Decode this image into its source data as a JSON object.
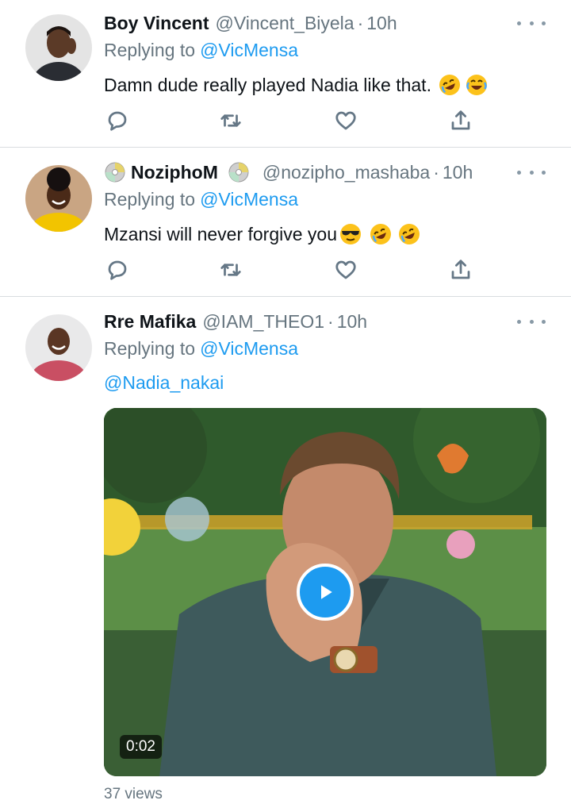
{
  "tweets": [
    {
      "name": "Boy Vincent",
      "handle": "@Vincent_Biyela",
      "separator": "·",
      "time": "10h",
      "replying_prefix": "Replying to",
      "replying_to": "@VicMensa",
      "text": "Damn dude really played Nadia like that.",
      "emojis": [
        "rofl-emoji",
        "joy-emoji"
      ]
    },
    {
      "name": "NoziphoM",
      "handle": "@nozipho_mashaba",
      "separator": "·",
      "time": "10h",
      "replying_prefix": "Replying to",
      "replying_to": "@VicMensa",
      "text": "Mzansi will never forgive you",
      "emojis": [
        "sunglasses-emoji",
        "rofl-emoji",
        "rofl-emoji"
      ]
    },
    {
      "name": "Rre Mafika",
      "handle": "@IAM_THEO1",
      "separator": "·",
      "time": "10h",
      "replying_prefix": "Replying to",
      "replying_to": "@VicMensa",
      "mention": "@Nadia_nakai",
      "video_duration": "0:02",
      "views": "37 views"
    }
  ],
  "icons": {
    "reply": "reply-icon",
    "retweet": "retweet-icon",
    "like": "heart-icon",
    "share": "share-icon",
    "more": "more-options-icon",
    "play": "play-icon"
  },
  "colors": {
    "link": "#1d9bf0",
    "secondary_text": "#66757f",
    "divider": "#d9dde0",
    "icon": "#657786"
  }
}
